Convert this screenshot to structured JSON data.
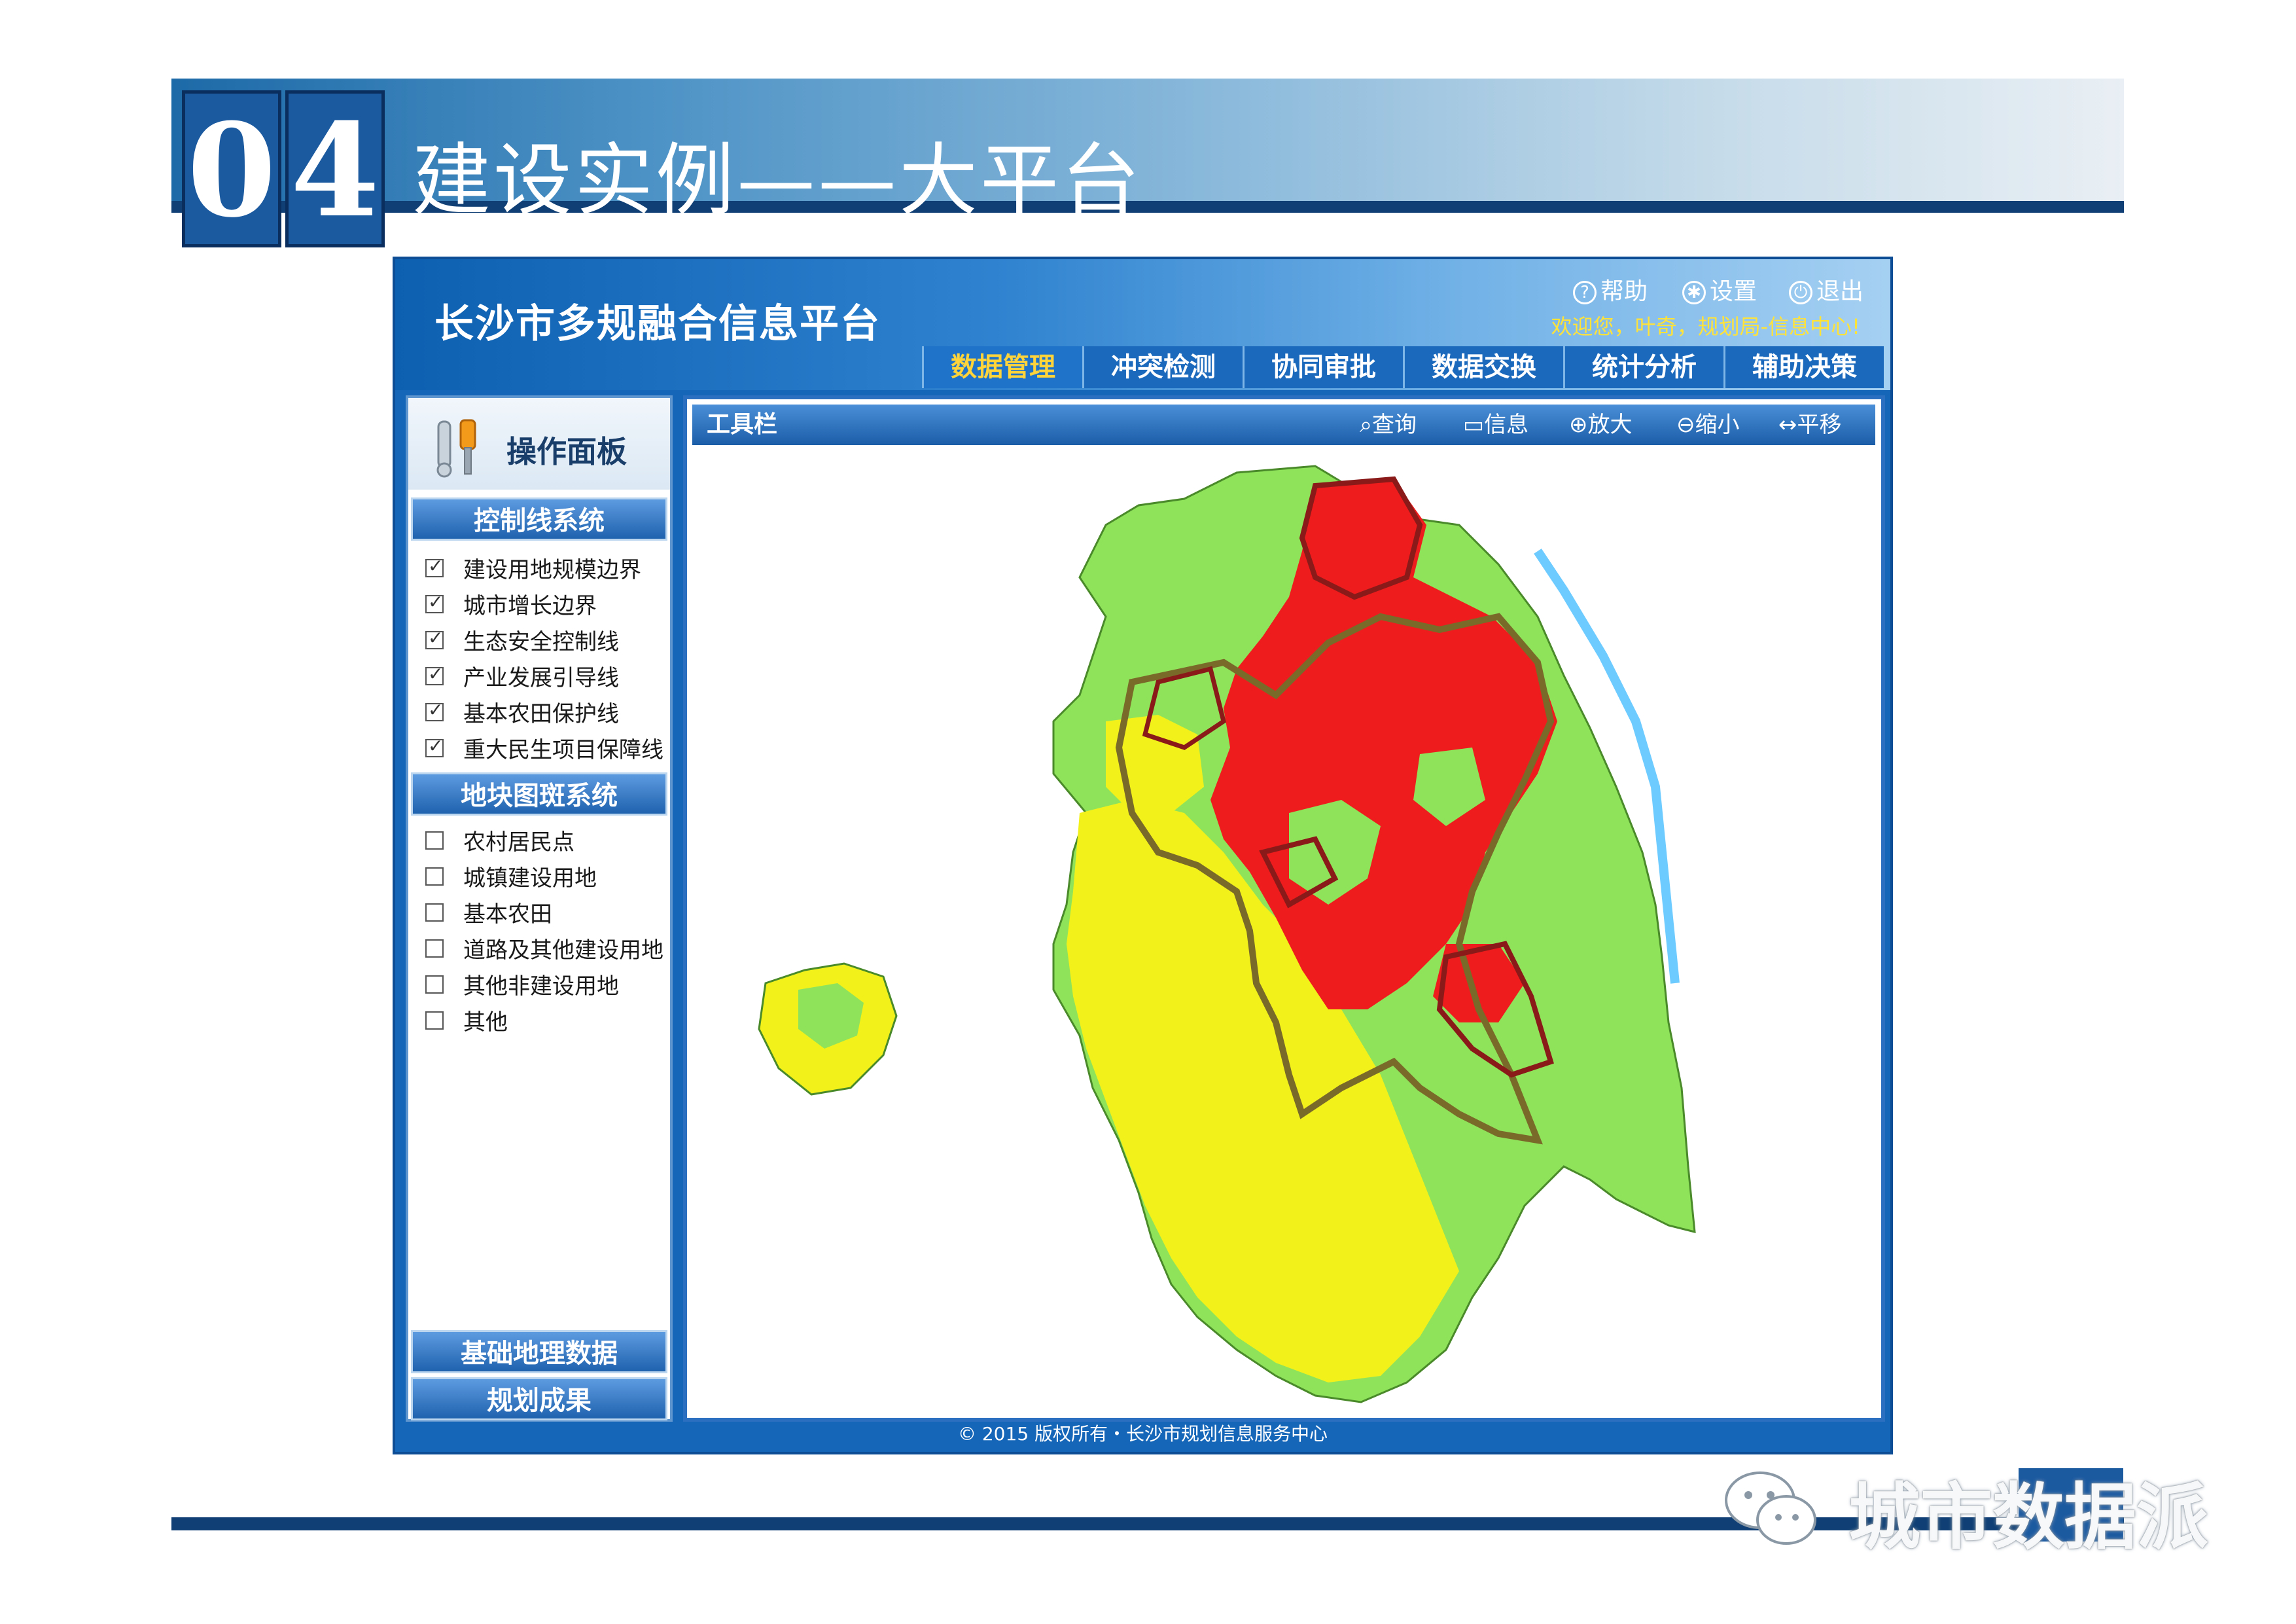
{
  "slide": {
    "section_digits": [
      "0",
      "4"
    ],
    "title": "建设实例——大平台"
  },
  "app": {
    "title": "长沙市多规融合信息平台",
    "utilities": {
      "help": "帮助",
      "settings": "设置",
      "logout": "退出"
    },
    "welcome": "欢迎您，叶奇，规划局-信息中心!",
    "nav": [
      {
        "label": "数据管理",
        "active": true
      },
      {
        "label": "冲突检测",
        "active": false
      },
      {
        "label": "协同审批",
        "active": false
      },
      {
        "label": "数据交换",
        "active": false
      },
      {
        "label": "统计分析",
        "active": false
      },
      {
        "label": "辅助决策",
        "active": false
      }
    ],
    "panel": {
      "title": "操作面板",
      "section1": {
        "label": "控制线系统",
        "items": [
          {
            "label": "建设用地规模边界",
            "checked": true
          },
          {
            "label": "城市增长边界",
            "checked": true
          },
          {
            "label": "生态安全控制线",
            "checked": true
          },
          {
            "label": "产业发展引导线",
            "checked": true
          },
          {
            "label": "基本农田保护线",
            "checked": true
          },
          {
            "label": "重大民生项目保障线",
            "checked": true
          }
        ]
      },
      "section2": {
        "label": "地块图斑系统",
        "items": [
          {
            "label": "农村居民点",
            "checked": false
          },
          {
            "label": "城镇建设用地",
            "checked": false
          },
          {
            "label": "基本农田",
            "checked": false
          },
          {
            "label": "道路及其他建设用地",
            "checked": false
          },
          {
            "label": "其他非建设用地",
            "checked": false
          },
          {
            "label": "其他",
            "checked": false
          }
        ]
      },
      "bottom_buttons": [
        "基础地理数据",
        "规划成果"
      ]
    },
    "toolbar": {
      "title": "工具栏",
      "buttons": [
        "查询",
        "信息",
        "放大",
        "缩小",
        "平移"
      ]
    },
    "footer": "© 2015 版权所有・长沙市规划信息服务中心"
  },
  "watermark": "城市数据派",
  "colors": {
    "primary_blue": "#1565b8",
    "nav_active": "#ffd33a",
    "welcome_text": "#ffe23a",
    "map_green": "#8fe35a",
    "map_yellow": "#f2f21a",
    "map_red": "#ee1c1c",
    "boundary": "#7a6a2a"
  }
}
